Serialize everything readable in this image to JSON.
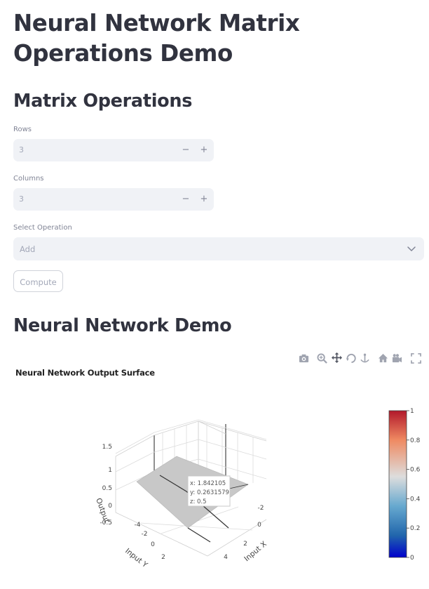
{
  "page": {
    "title": "Neural Network Matrix Operations Demo",
    "section_matrix": "Matrix Operations",
    "section_nn": "Neural Network Demo"
  },
  "form": {
    "rows_label": "Rows",
    "rows_value": "3",
    "cols_label": "Columns",
    "cols_value": "3",
    "minus_symbol": "−",
    "plus_symbol": "+",
    "operation_label": "Select Operation",
    "operation_value": "Add",
    "compute_button": "Compute"
  },
  "modebar": {
    "icons": [
      "camera-icon",
      "zoom-icon",
      "pan-icon",
      "orbit-rotation-icon",
      "turntable-rotation-icon",
      "reset-camera-icon",
      "last-saved-camera-icon",
      "fullscreen-icon"
    ]
  },
  "chart_data": {
    "type": "surface",
    "title": "Neural Network Output Surface",
    "xlabel": "Input X",
    "ylabel": "Input Y",
    "zlabel": "Output",
    "x_ticks": [
      "-2",
      "0",
      "2",
      "4"
    ],
    "y_ticks": [
      "-4",
      "-2",
      "0",
      "2"
    ],
    "z_ticks": [
      "1.5",
      "1",
      "0.5",
      "0",
      "-0.5"
    ],
    "surface_value": 0.5,
    "surface_color": "#c8c8c8",
    "colorbar": {
      "min": 0,
      "max": 1,
      "ticks": [
        "1",
        "0.8",
        "0.6",
        "0.4",
        "0.2",
        "0"
      ],
      "colors": [
        "#b2182b",
        "#ef8a62",
        "#dddddd",
        "#67a9cf",
        "#2166ac",
        "#0000cc"
      ]
    },
    "hover": {
      "x": "x: 1.842105",
      "y": "y: 0.2631579",
      "z": "z: 0.5"
    }
  }
}
